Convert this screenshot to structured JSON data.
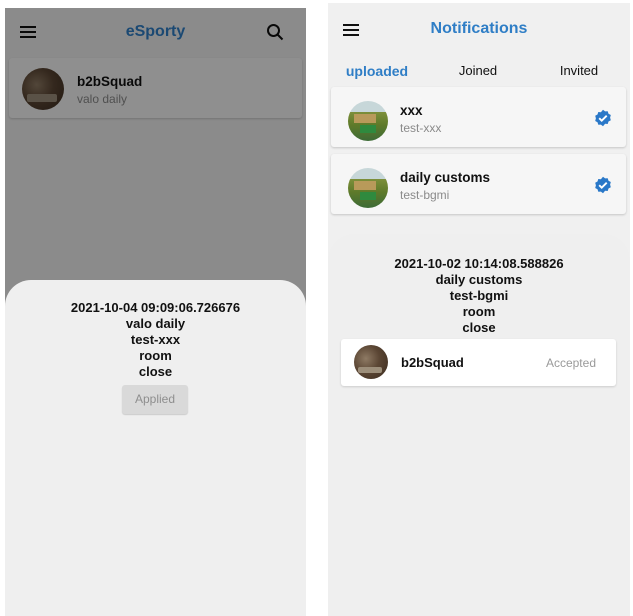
{
  "left_screen": {
    "appbar": {
      "title": "eSporty",
      "menu_icon": "hamburger-menu-icon",
      "search_icon": "search-icon"
    },
    "list_item": {
      "title": "b2bSquad",
      "subtitle": "valo daily"
    },
    "sheet": {
      "lines": [
        "2021-10-04 09:09:06.726676",
        "valo daily",
        "test-xxx",
        "room",
        "close"
      ],
      "button_label": "Applied"
    }
  },
  "right_screen": {
    "appbar": {
      "title": "Notifications",
      "menu_icon": "hamburger-menu-icon"
    },
    "tabs": [
      {
        "label": "uploaded",
        "active": true
      },
      {
        "label": "Joined",
        "active": false
      },
      {
        "label": "Invited",
        "active": false
      }
    ],
    "items": [
      {
        "title": "xxx",
        "subtitle": "test-xxx",
        "status_icon": "verified-check-icon"
      },
      {
        "title": "daily customs",
        "subtitle": "test-bgmi",
        "status_icon": "verified-check-icon"
      }
    ],
    "sheet": {
      "lines": [
        "2021-10-02 10:14:08.588826",
        "daily customs",
        "test-bgmi",
        "room",
        "close"
      ],
      "member": {
        "name": "b2bSquad",
        "status": "Accepted"
      }
    }
  },
  "colors": {
    "accent": "#2f7ec6",
    "check": "#2a78c8",
    "muted": "#8a8a8a"
  }
}
